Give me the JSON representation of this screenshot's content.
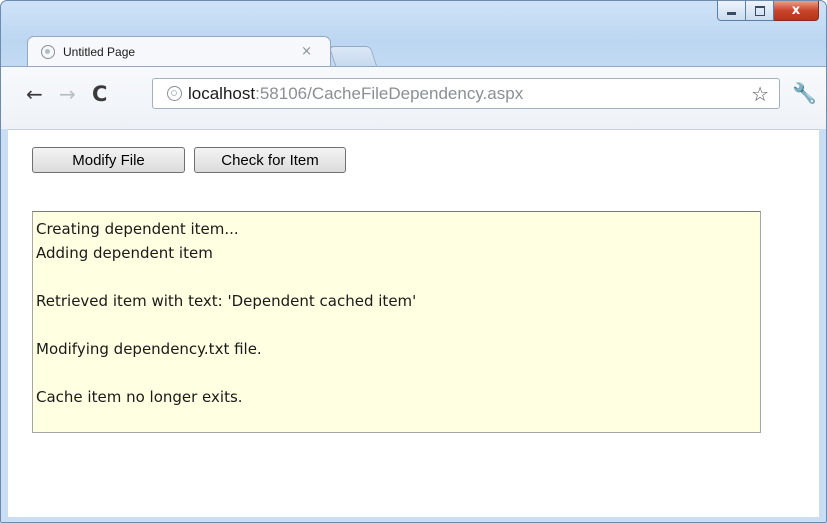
{
  "window": {
    "caption_buttons": [
      "minimize",
      "maximize",
      "close"
    ],
    "close_glyph": "x"
  },
  "tab": {
    "title": "Untitled Page",
    "close_glyph": "×"
  },
  "toolbar": {
    "url_host": "localhost",
    "url_rest": ":58106/CacheFileDependency.aspx"
  },
  "page": {
    "modify_button": "Modify File",
    "check_button": "Check for Item",
    "log": {
      "line1": "Creating dependent item...",
      "line2": "Adding dependent item",
      "line3": "Retrieved item with text: 'Dependent cached item'",
      "line4": "Modifying dependency.txt file.",
      "line5": "Cache item no longer exits."
    },
    "log_background": "#ffffe1"
  }
}
